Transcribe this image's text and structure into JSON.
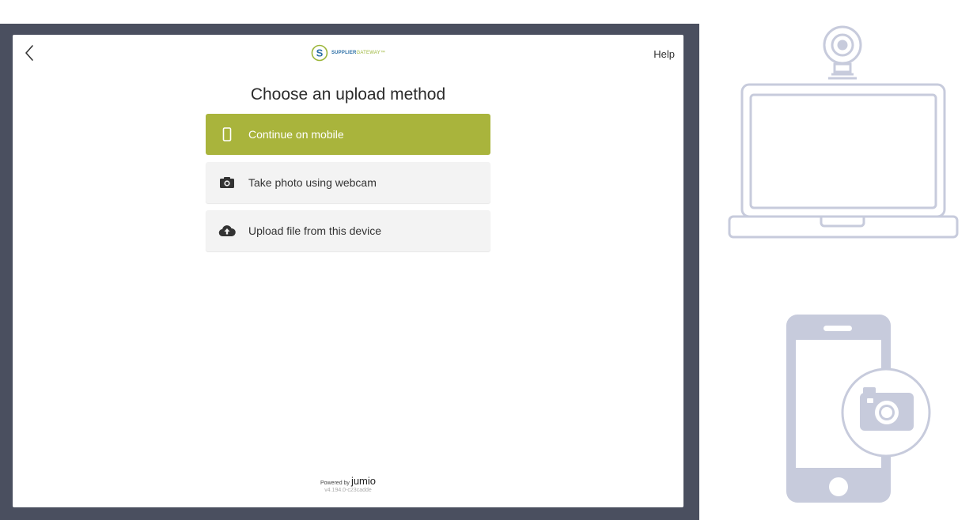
{
  "header": {
    "logo_text_primary": "SUPPLIER",
    "logo_text_secondary": "GATEWAY™",
    "logo_letter": "S",
    "help_label": "Help"
  },
  "title": "Choose an upload method",
  "options": [
    {
      "label": "Continue on mobile",
      "icon": "mobile-phone-icon"
    },
    {
      "label": "Take photo using webcam",
      "icon": "camera-icon"
    },
    {
      "label": "Upload file from this device",
      "icon": "cloud-upload-icon"
    }
  ],
  "footer": {
    "powered_by": "Powered by",
    "brand": "jumio",
    "version": "v4.194.0-c23cadde"
  },
  "colors": {
    "bezel": "#4a4f5f",
    "accent": "#a9b43c",
    "illustration": "#c7cbdc"
  }
}
